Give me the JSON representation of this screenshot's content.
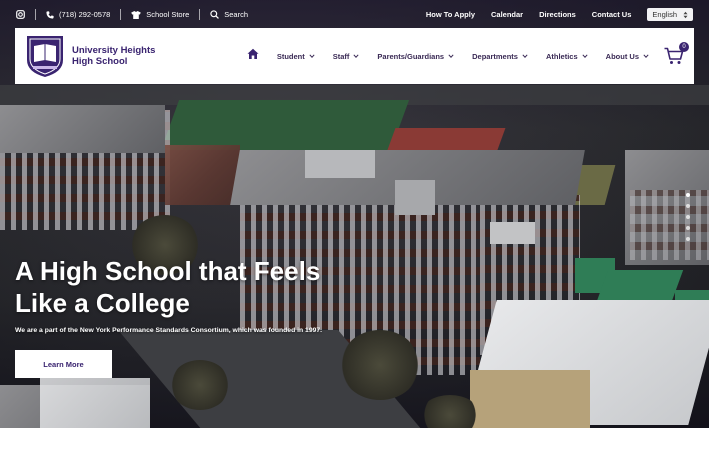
{
  "topbar": {
    "phone": "(718) 292-0578",
    "store": "School Store",
    "search": "Search",
    "links": [
      "How To Apply",
      "Calendar",
      "Directions",
      "Contact Us"
    ],
    "language": "English"
  },
  "brand": {
    "line1": "University Heights",
    "line2": "High School"
  },
  "nav": {
    "items": [
      "Student",
      "Staff",
      "Parents/Guardians",
      "Departments",
      "Athletics",
      "About Us"
    ],
    "cart_count": "0"
  },
  "hero": {
    "title_line1": "A High School that Feels",
    "title_line2": "Like a College",
    "subtitle": "We are a part of the New York Performance Standards Consortium, which was founded in 1997.",
    "cta": "Learn More"
  },
  "colors": {
    "brand_purple": "#3a2470",
    "white": "#ffffff"
  }
}
